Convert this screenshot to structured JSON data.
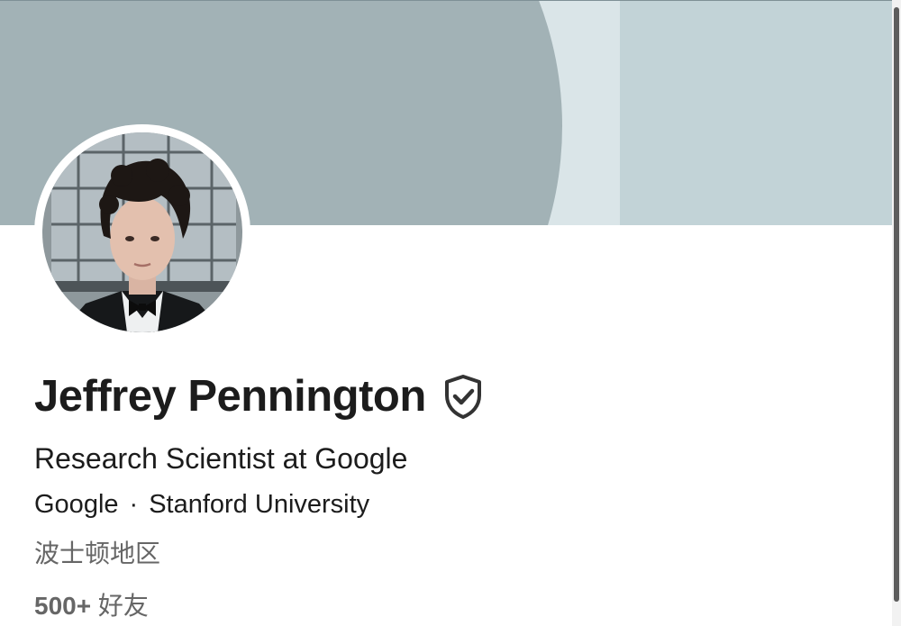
{
  "profile": {
    "name": "Jeffrey Pennington",
    "headline": "Research Scientist at Google",
    "company": "Google",
    "separator": "·",
    "school": "Stanford University",
    "location": "波士顿地区",
    "connections_count": "500+",
    "connections_label": "好友",
    "verified_icon": "shield-check-icon",
    "avatar_icon": "profile-photo"
  },
  "colors": {
    "banner_dark": "#a2b2b6",
    "banner_light": "#dae5e8",
    "banner_base": "#c2d3d7",
    "text_primary": "#1c1c1c",
    "text_secondary": "#666666"
  }
}
